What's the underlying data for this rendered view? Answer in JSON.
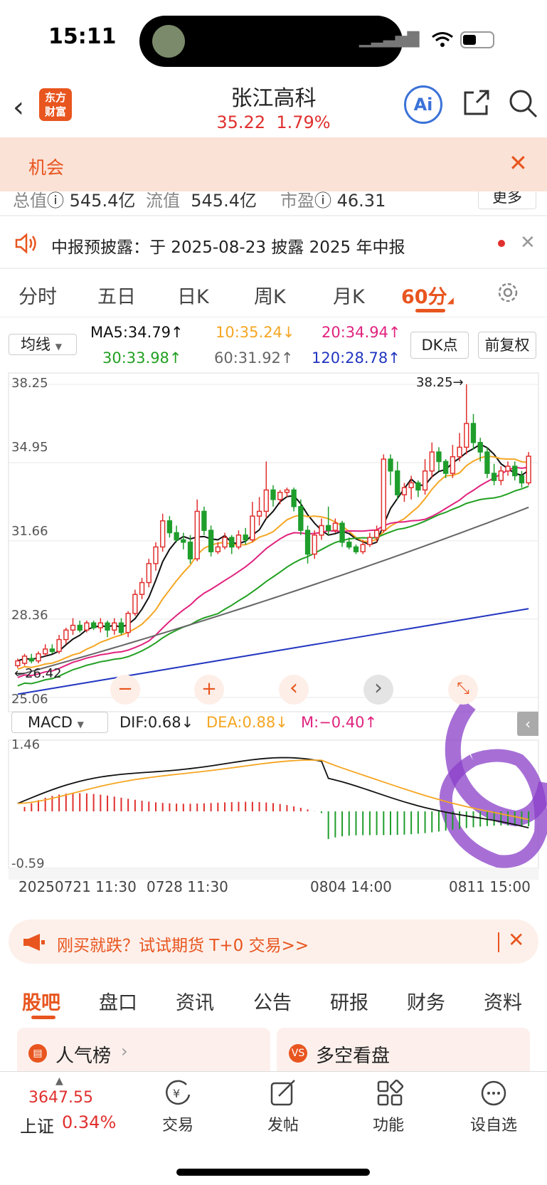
{
  "status_bar": {
    "time": "15:11"
  },
  "header": {
    "back_icon": "chevron-left-icon",
    "logo_text": "东方\n财富",
    "stock_name": "张江高科",
    "price": "35.22",
    "change_pct": "1.79%",
    "ai_label": "Ai",
    "share_icon": "share-icon",
    "search_icon": "search-icon"
  },
  "banner": {
    "text": "机会",
    "close": "✕"
  },
  "stats": [
    {
      "label": "总值",
      "value": "545.4亿"
    },
    {
      "label": "流值",
      "value": "545.4亿"
    },
    {
      "label": "市盈",
      "value": "46.31"
    }
  ],
  "more_label": "更多",
  "notice": {
    "text": "中报预披露：于 2025-08-23 披露 2025 年中报",
    "close": "✕"
  },
  "period_tabs": [
    "分时",
    "五日",
    "日K",
    "周K",
    "月K",
    "60分"
  ],
  "active_tab": "60分",
  "ma": {
    "select": "均线",
    "ma5": "MA5:34.79↑",
    "ma10": "10:35.24↓",
    "ma20": "20:34.94↑",
    "ma30": "30:33.98↑",
    "ma60": "60:31.92↑",
    "ma120": "120:28.78↑",
    "dk_label": "DK点",
    "fq_label": "前复权"
  },
  "colors": {
    "accent": "#e8551f",
    "up": "#e0302e",
    "down": "#1f9e2c",
    "ma5": "#111111",
    "ma10": "#f5a623",
    "ma20": "#e0237f",
    "ma30": "#22a022",
    "ma60": "#666666",
    "ma120": "#2236c0"
  },
  "chart_data": {
    "type": "candlestick",
    "y_ticks": [
      "38.25",
      "34.95",
      "31.66",
      "28.36",
      "25.06"
    ],
    "ylim": [
      25.06,
      38.25
    ],
    "high_label": "38.25→",
    "low_label": "←26.42",
    "candles": [
      [
        26.4,
        26.6,
        26.3,
        26.7
      ],
      [
        26.5,
        26.8,
        26.4,
        26.9
      ],
      [
        26.7,
        26.6,
        26.5,
        26.9
      ],
      [
        26.6,
        26.9,
        26.5,
        27.0
      ],
      [
        26.9,
        27.1,
        26.8,
        27.3
      ],
      [
        27.1,
        27.0,
        26.9,
        27.3
      ],
      [
        27.0,
        27.5,
        26.9,
        27.7
      ],
      [
        27.5,
        27.9,
        27.3,
        28.0
      ],
      [
        27.9,
        28.1,
        27.7,
        28.4
      ],
      [
        28.1,
        27.9,
        27.8,
        28.3
      ],
      [
        27.9,
        28.2,
        27.8,
        28.3
      ],
      [
        28.2,
        28.0,
        27.9,
        28.3
      ],
      [
        28.0,
        28.2,
        27.8,
        28.4
      ],
      [
        28.2,
        27.9,
        27.6,
        28.3
      ],
      [
        27.9,
        28.2,
        27.7,
        28.4
      ],
      [
        28.2,
        27.8,
        27.7,
        28.4
      ],
      [
        27.8,
        28.6,
        27.6,
        28.7
      ],
      [
        28.6,
        29.4,
        28.5,
        29.6
      ],
      [
        29.4,
        29.9,
        29.2,
        30.1
      ],
      [
        29.9,
        30.7,
        29.7,
        30.9
      ],
      [
        30.7,
        31.4,
        30.4,
        31.6
      ],
      [
        31.4,
        32.5,
        31.2,
        32.8
      ],
      [
        32.5,
        32.0,
        31.8,
        32.7
      ],
      [
        32.0,
        31.7,
        31.6,
        32.3
      ],
      [
        31.7,
        31.6,
        31.3,
        32.0
      ],
      [
        31.6,
        30.9,
        30.7,
        31.9
      ],
      [
        30.9,
        32.9,
        30.8,
        33.4
      ],
      [
        32.9,
        32.1,
        31.9,
        33.1
      ],
      [
        32.1,
        31.2,
        31.0,
        32.3
      ],
      [
        31.2,
        31.4,
        31.1,
        31.6
      ],
      [
        31.4,
        31.8,
        31.3,
        32.0
      ],
      [
        31.8,
        31.4,
        31.1,
        31.9
      ],
      [
        31.4,
        31.9,
        31.3,
        32.1
      ],
      [
        31.9,
        31.7,
        31.5,
        32.2
      ],
      [
        31.7,
        32.7,
        31.6,
        33.3
      ],
      [
        32.7,
        32.9,
        32.3,
        33.5
      ],
      [
        32.9,
        33.8,
        32.6,
        35.0
      ],
      [
        33.8,
        33.4,
        33.1,
        34.0
      ],
      [
        33.4,
        33.7,
        33.2,
        33.8
      ],
      [
        33.7,
        33.8,
        33.5,
        33.9
      ],
      [
        33.8,
        33.1,
        32.9,
        33.9
      ],
      [
        33.1,
        32.1,
        31.9,
        33.4
      ],
      [
        32.1,
        31.1,
        30.7,
        32.3
      ],
      [
        31.1,
        31.9,
        30.9,
        32.1
      ],
      [
        31.9,
        32.3,
        31.7,
        32.6
      ],
      [
        32.3,
        32.1,
        31.9,
        33.1
      ],
      [
        32.1,
        32.4,
        32.0,
        32.6
      ],
      [
        32.4,
        31.6,
        31.4,
        32.5
      ],
      [
        31.6,
        31.4,
        31.3,
        31.8
      ],
      [
        31.4,
        31.2,
        31.1,
        31.5
      ],
      [
        31.2,
        31.5,
        31.1,
        31.7
      ],
      [
        31.5,
        31.8,
        31.4,
        32.0
      ],
      [
        31.8,
        32.1,
        31.6,
        32.3
      ],
      [
        32.1,
        35.1,
        32.0,
        35.3
      ],
      [
        35.1,
        34.6,
        34.0,
        35.3
      ],
      [
        34.6,
        33.6,
        33.4,
        35.0
      ],
      [
        33.6,
        33.9,
        33.3,
        34.1
      ],
      [
        33.9,
        34.1,
        33.4,
        34.4
      ],
      [
        34.1,
        33.8,
        33.5,
        34.2
      ],
      [
        33.8,
        34.6,
        33.6,
        35.1
      ],
      [
        34.6,
        35.4,
        34.3,
        35.8
      ],
      [
        35.4,
        35.0,
        34.6,
        35.6
      ],
      [
        35.0,
        34.5,
        34.3,
        35.1
      ],
      [
        34.5,
        35.2,
        34.3,
        35.7
      ],
      [
        35.2,
        35.6,
        35.0,
        36.2
      ],
      [
        35.6,
        36.6,
        35.3,
        38.25
      ],
      [
        36.6,
        35.8,
        35.5,
        37.0
      ],
      [
        35.8,
        35.4,
        35.0,
        36.0
      ],
      [
        35.4,
        34.5,
        34.3,
        35.6
      ],
      [
        34.5,
        34.2,
        34.0,
        34.9
      ],
      [
        34.2,
        34.6,
        34.0,
        34.8
      ],
      [
        34.6,
        34.8,
        34.4,
        35.0
      ],
      [
        34.8,
        34.4,
        34.2,
        35.0
      ],
      [
        34.4,
        34.1,
        33.9,
        34.6
      ],
      [
        34.1,
        35.22,
        34.0,
        35.4
      ]
    ],
    "macd_ticks": [
      "1.46",
      "-0.59"
    ],
    "macd_values": {
      "dif": "DIF:0.68↓",
      "dea": "DEA:0.88↓",
      "m": "M:−0.40↑"
    },
    "x_ticks": [
      "20250721 11:30",
      "0728 11:30",
      "0804 14:00",
      "0811 15:00"
    ]
  },
  "chart_controls": [
    "−",
    "+",
    "‹",
    "›",
    "⤡"
  ],
  "futures_banner": {
    "text": "刚买就跌？试试期货 T+0 交易>>",
    "close": "✕"
  },
  "bottom_tabs": [
    "股吧",
    "盘口",
    "资讯",
    "公告",
    "研报",
    "财务",
    "资料"
  ],
  "cards": [
    {
      "icon": "▤",
      "label": "人气榜"
    },
    {
      "icon": "VS",
      "label": "多空看盘"
    }
  ],
  "nav": {
    "index_value": "3647.55",
    "index_name": "上证",
    "index_pct": "0.34%",
    "items": [
      "交易",
      "发帖",
      "功能",
      "设自选"
    ]
  }
}
